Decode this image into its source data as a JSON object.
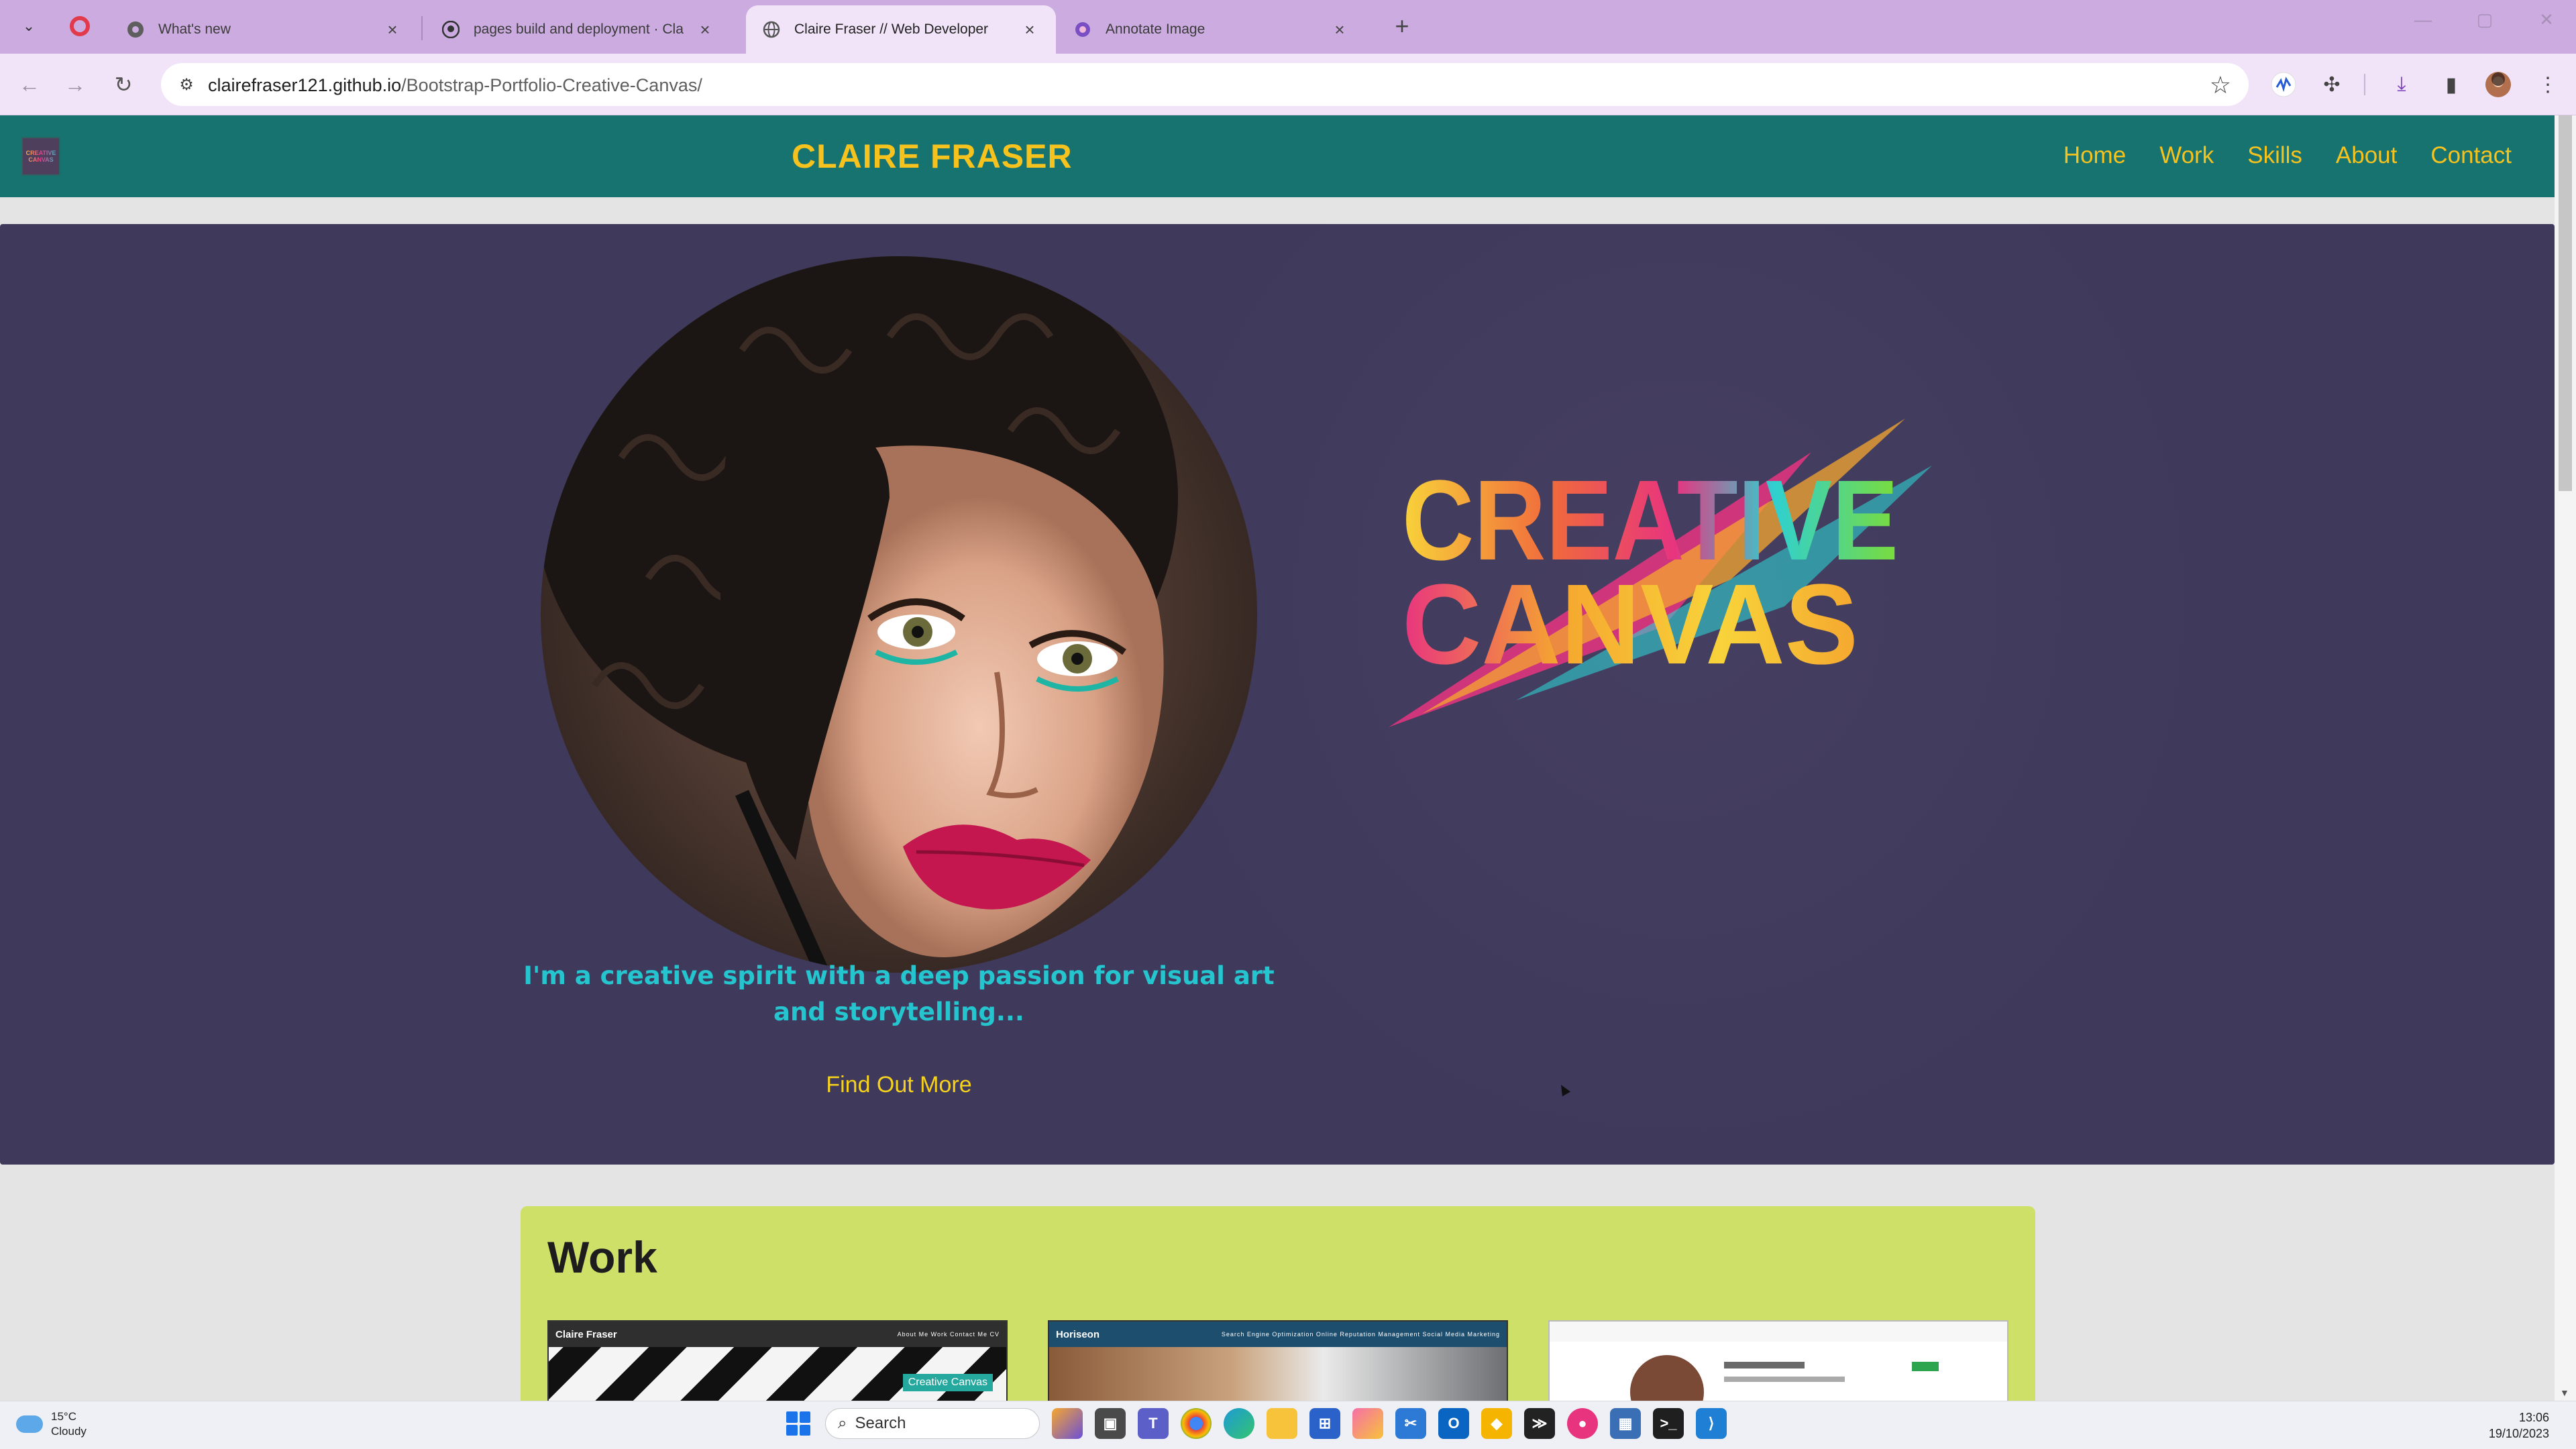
{
  "browser": {
    "tabs": [
      {
        "title": "What's new",
        "favicon": "chrome-icon",
        "active": false
      },
      {
        "title": "pages build and deployment · Cla",
        "favicon": "github-icon",
        "active": false
      },
      {
        "title": "Claire Fraser // Web Developer",
        "favicon": "globe-icon",
        "active": true
      },
      {
        "title": "Annotate Image",
        "favicon": "annotate-icon",
        "active": false
      }
    ],
    "url_domain": "clairefraser121.github.io",
    "url_path": "/Bootstrap-Portfolio-Creative-Canvas/",
    "window_controls": {
      "minimize": "—",
      "maximize": "▢",
      "close": "✕"
    }
  },
  "site": {
    "logo_text": "CREATIVE CANVAS",
    "brand": "CLAIRE FRASER",
    "nav": [
      "Home",
      "Work",
      "Skills",
      "About",
      "Contact"
    ],
    "hero": {
      "logo_line1": "CREATIVE",
      "logo_line2": "CANVAS",
      "tagline": "I'm a creative spirit with a deep passion for visual art and storytelling...",
      "cta": "Find Out More"
    },
    "work": {
      "heading": "Work",
      "cards": [
        {
          "title": "Claire Fraser",
          "links": "About Me   Work   Contact Me   CV",
          "badge": "Creative Canvas"
        },
        {
          "title": "Horiseon",
          "links": "Search Engine Optimization   Online Reputation Management   Social Media Marketing"
        },
        {
          "title": "",
          "links": ""
        }
      ]
    }
  },
  "taskbar": {
    "weather_temp": "15°C",
    "weather_desc": "Cloudy",
    "search_placeholder": "Search",
    "time": "13:06",
    "date": "19/10/2023"
  },
  "colors": {
    "nav_bg": "#177370",
    "accent_yellow": "#f6c21d",
    "hero_bg": "#3f3a5b",
    "tagline_cyan": "#25c5cf",
    "work_bg": "#cfe069"
  }
}
